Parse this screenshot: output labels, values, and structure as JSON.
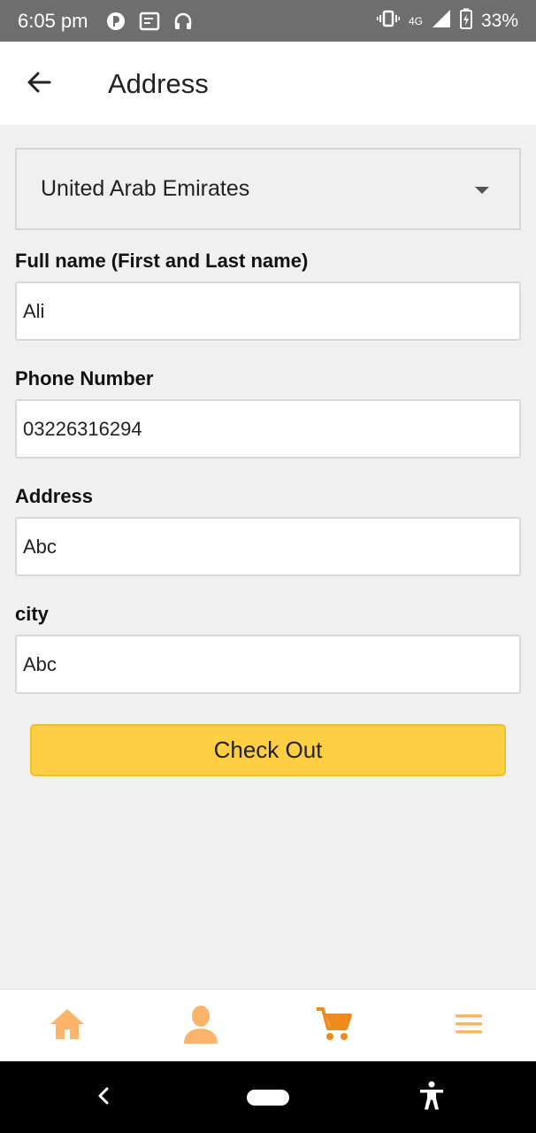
{
  "status_bar": {
    "time": "6:05 pm",
    "network": "4G",
    "battery": "33%",
    "icons": [
      "app-notification-icon",
      "screen-cast-icon",
      "headphones-icon",
      "vibrate-icon",
      "signal-icon",
      "battery-charging-icon"
    ]
  },
  "app_bar": {
    "title": "Address",
    "back_icon": "arrow-left-icon"
  },
  "form": {
    "country": "United Arab Emirates",
    "full_name_label": "Full name (First and Last name)",
    "full_name_value": "Ali",
    "phone_label": "Phone Number",
    "phone_value": "03226316294",
    "address_label": "Address",
    "address_value": "Abc",
    "city_label": "city",
    "city_value": "Abc",
    "checkout_label": "Check Out"
  },
  "bottom_nav": {
    "items": [
      "home-icon",
      "profile-icon",
      "cart-icon",
      "menu-icon"
    ],
    "active": "cart-icon",
    "colors": {
      "inactive": "#fbb46a",
      "active": "#f08a1c"
    }
  },
  "system_nav": {
    "items": [
      "back-icon",
      "home-pill",
      "accessibility-icon"
    ]
  }
}
